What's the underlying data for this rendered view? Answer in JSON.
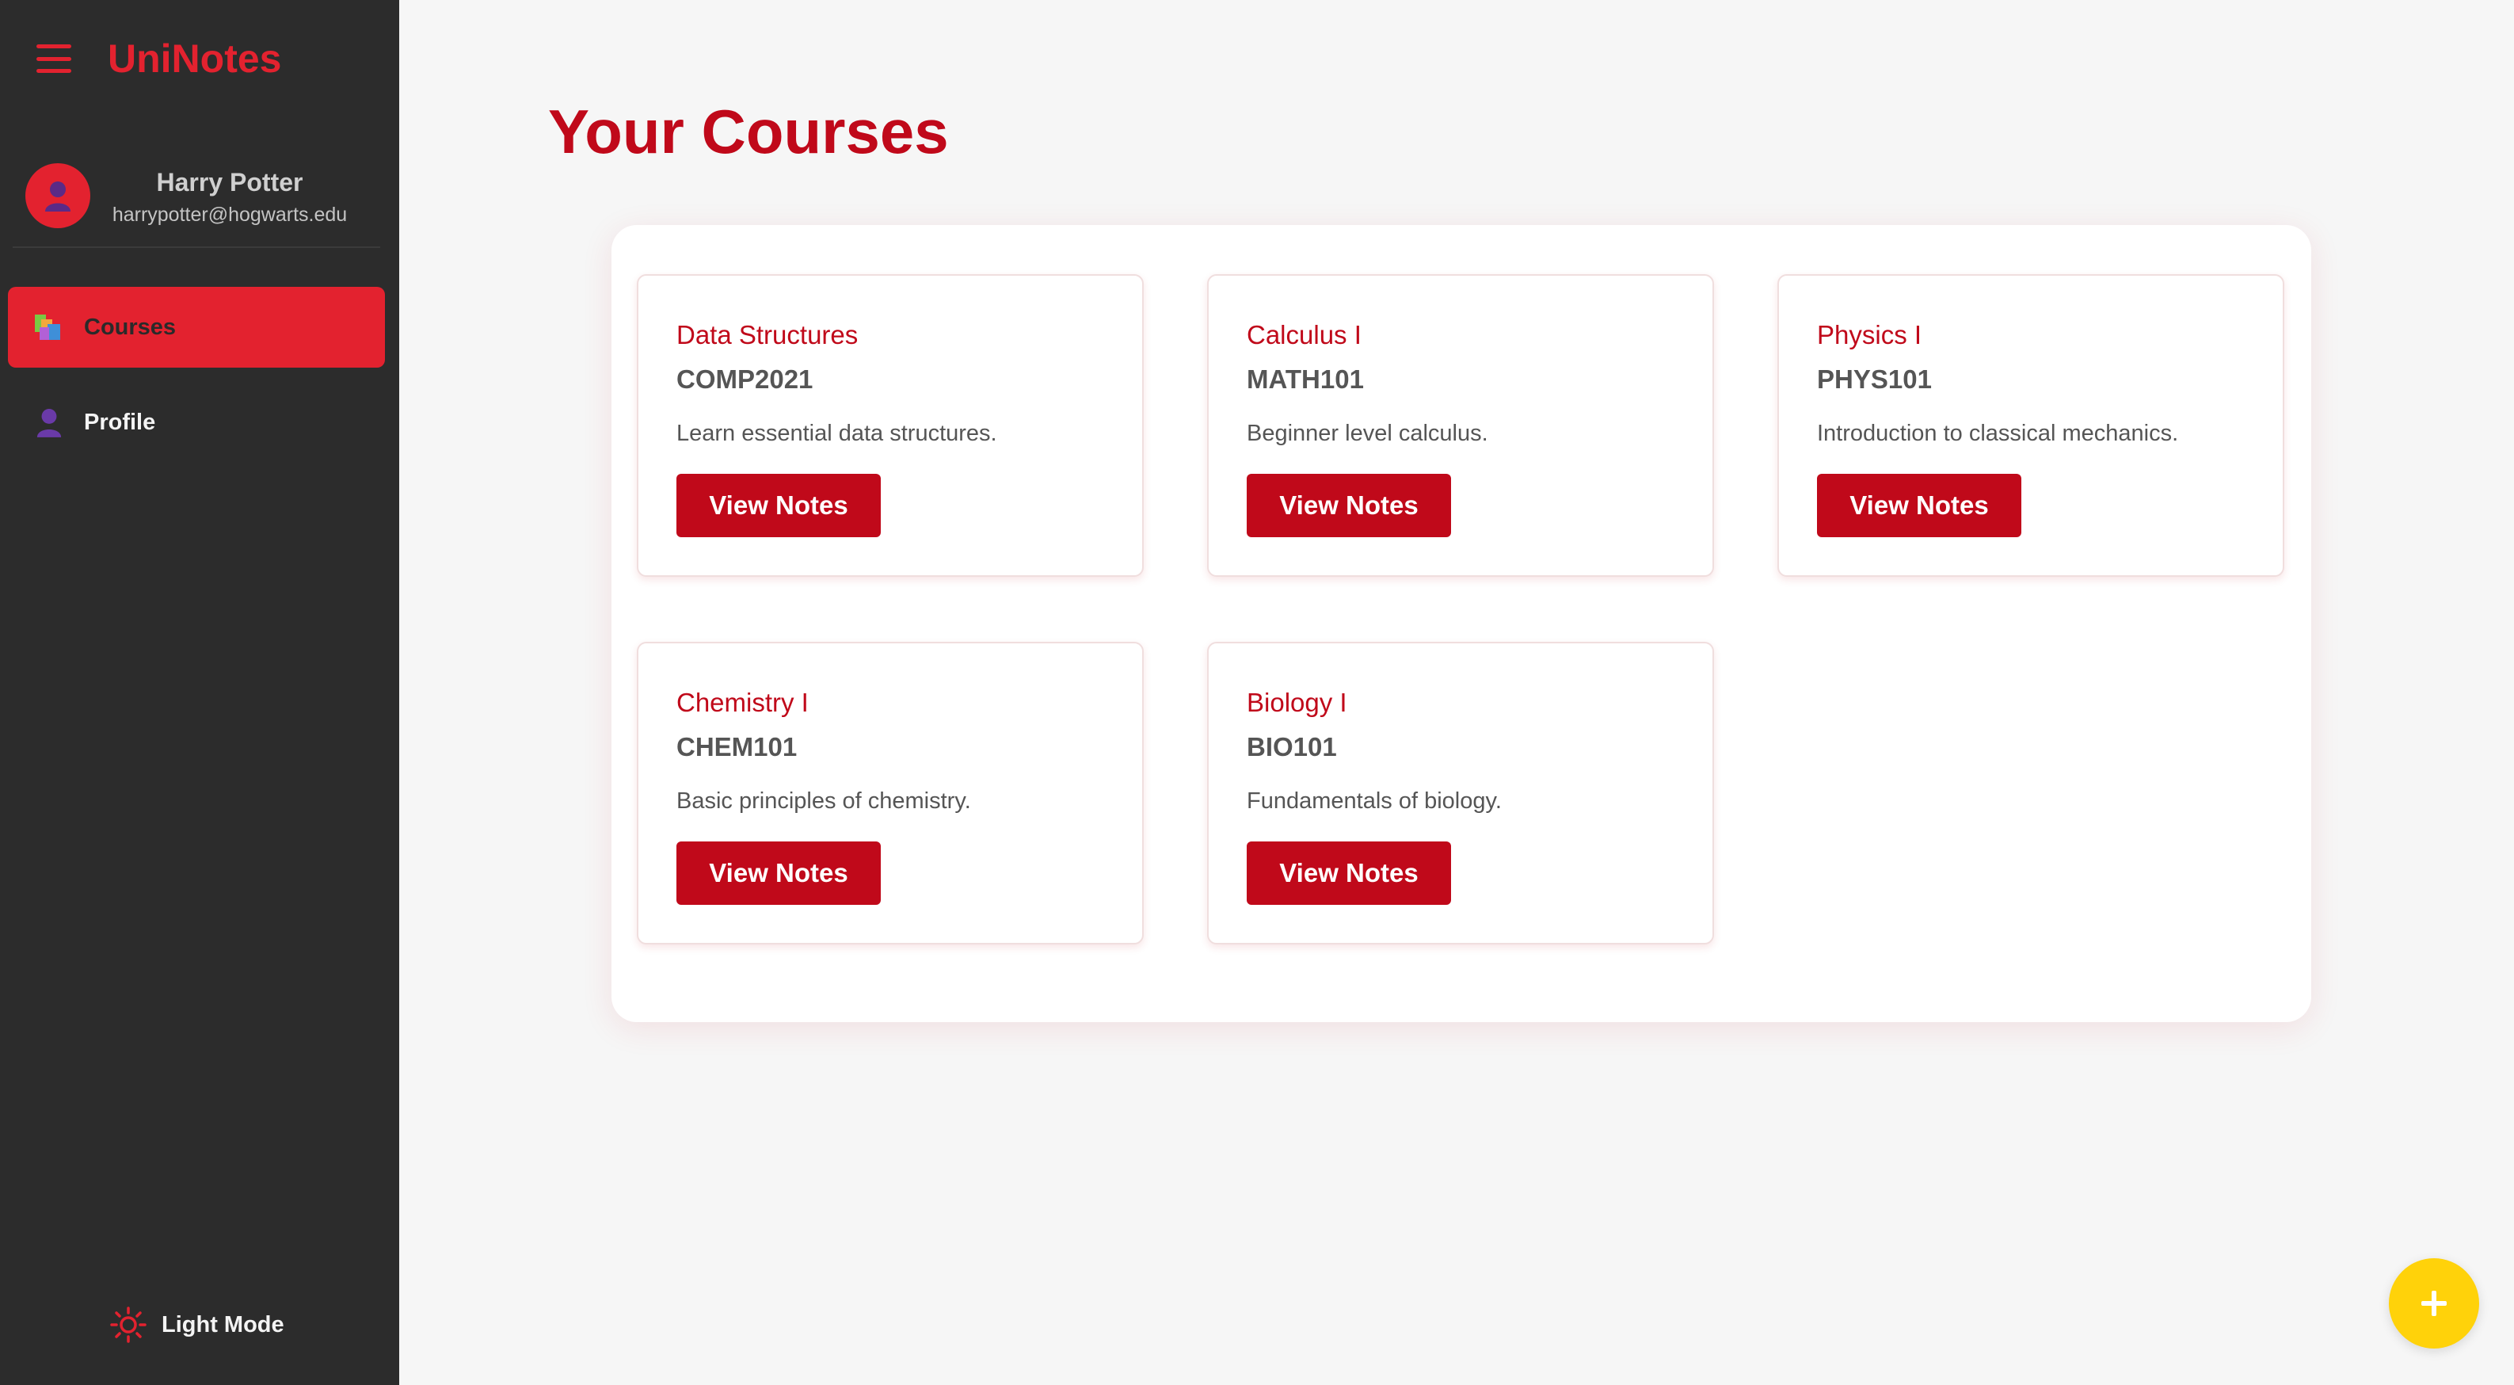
{
  "app": {
    "brand": "UniNotes"
  },
  "sidebar": {
    "user": {
      "name": "Harry Potter",
      "email": "harrypotter@hogwarts.edu"
    },
    "items": [
      {
        "label": "Courses",
        "icon": "books-icon",
        "active": true
      },
      {
        "label": "Profile",
        "icon": "person-icon",
        "active": false
      }
    ],
    "theme_toggle": {
      "label": "Light Mode",
      "icon": "sun-icon"
    }
  },
  "main": {
    "title": "Your Courses",
    "courses": [
      {
        "name": "Data Structures",
        "code": "COMP2021",
        "description": "Learn essential data structures.",
        "button": "View Notes"
      },
      {
        "name": "Calculus I",
        "code": "MATH101",
        "description": "Beginner level calculus.",
        "button": "View Notes"
      },
      {
        "name": "Physics I",
        "code": "PHYS101",
        "description": "Introduction to classical mechanics.",
        "button": "View Notes"
      },
      {
        "name": "Chemistry I",
        "code": "CHEM101",
        "description": "Basic principles of chemistry.",
        "button": "View Notes"
      },
      {
        "name": "Biology I",
        "code": "BIO101",
        "description": "Fundamentals of biology.",
        "button": "View Notes"
      }
    ]
  },
  "fab": {
    "icon": "plus-icon"
  },
  "colors": {
    "accent": "#e3222f",
    "primary": "#c0091a",
    "sidebar_bg": "#2c2c2c",
    "fab": "#ffd20a"
  }
}
